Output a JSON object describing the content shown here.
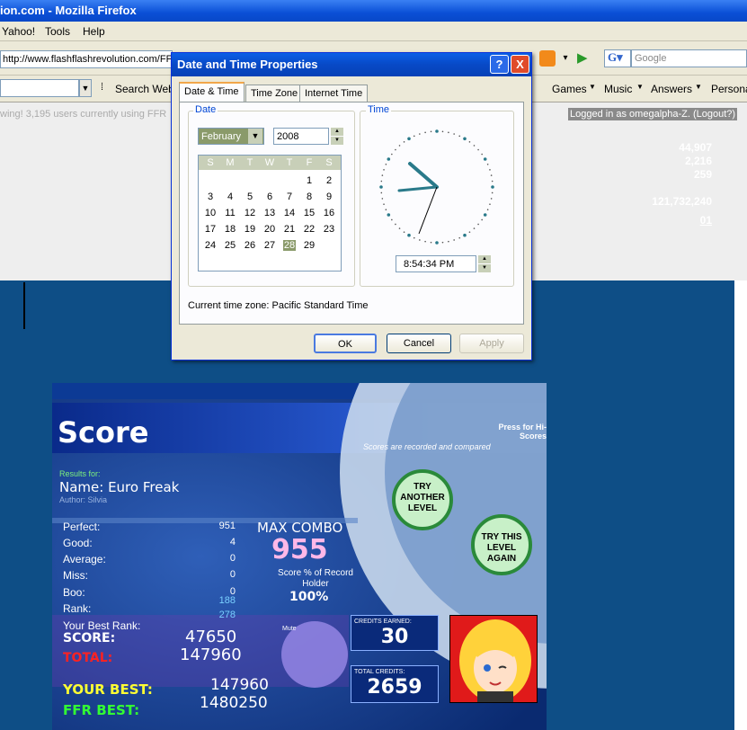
{
  "browser": {
    "title": "ion.com - Mozilla Firefox",
    "menu": [
      "Yahoo!",
      "Tools",
      "Help"
    ],
    "url": "http://www.flashflashrevolution.com/FFR",
    "search_placeholder": "Google",
    "search_web_label": "Search Web",
    "nav_links": [
      "Games",
      "Music",
      "Answers",
      "Persona"
    ]
  },
  "site": {
    "users_online": "wing! 3,195 users currently using FFR",
    "logged_in": "Logged in as omegalpha-Z. (Logout?)",
    "stats": [
      "44,907",
      "2,216",
      "259",
      "121,732,240",
      "01"
    ]
  },
  "dialog": {
    "title": "Date and Time Properties",
    "tabs": [
      "Date & Time",
      "Time Zone",
      "Internet Time"
    ],
    "date_label": "Date",
    "time_label": "Time",
    "month": "February",
    "year": "2008",
    "weekdays": [
      "S",
      "M",
      "T",
      "W",
      "T",
      "F",
      "S"
    ],
    "weeks": [
      [
        "",
        "",
        "",
        "",
        "",
        "1",
        "2"
      ],
      [
        "3",
        "4",
        "5",
        "6",
        "7",
        "8",
        "9"
      ],
      [
        "10",
        "11",
        "12",
        "13",
        "14",
        "15",
        "16"
      ],
      [
        "17",
        "18",
        "19",
        "20",
        "21",
        "22",
        "23"
      ],
      [
        "24",
        "25",
        "26",
        "27",
        "28",
        "29",
        ""
      ]
    ],
    "selected_day": "28",
    "time_value": "8:54:34 PM",
    "timezone_text": "Current time zone:  Pacific Standard Time",
    "ok": "OK",
    "cancel": "Cancel",
    "apply": "Apply",
    "help_glyph": "?",
    "close_glyph": "X"
  },
  "game": {
    "heading": "Score",
    "press_hiscores": "Press for Hi-Scores",
    "scores_recorded": "Scores are recorded and compared",
    "results_for": "Results for:",
    "song_name": "Name: Euro Freak",
    "author": "Author: Silvia",
    "judgements": [
      {
        "label": "Perfect:",
        "value": "951"
      },
      {
        "label": "Good:",
        "value": "4"
      },
      {
        "label": "Average:",
        "value": "0"
      },
      {
        "label": "Miss:",
        "value": "0"
      },
      {
        "label": "Boo:",
        "value": "0"
      },
      {
        "label": "Rank:",
        "value": "188"
      }
    ],
    "rank_extra": "278",
    "max_combo_label": "MAX COMBO",
    "max_combo": "955",
    "score_pct_label": "Score % of Record Holder",
    "score_pct": "100%",
    "try_another": "TRY ANOTHER LEVEL",
    "try_again": "TRY THIS LEVEL AGAIN",
    "best_rank_label": "Your Best Rank:",
    "score_label": "SCORE:",
    "score_value": "47650",
    "total_label": "TOTAL:",
    "total_value": "147960",
    "your_best_label": "YOUR BEST:",
    "your_best_value": "147960",
    "ffr_best_label": "FFR BEST:",
    "ffr_best_value": "1480250",
    "credits_earned_label": "CREDITS EARNED:",
    "credits_earned": "30",
    "total_credits_label": "TOTAL CREDITS:",
    "total_credits": "2659",
    "mute_label": "Mute"
  },
  "colors": {
    "xp_blue": "#0a5fe6",
    "page_blue": "#0e4e86",
    "game_green": "#33ff33",
    "game_red": "#ff2222",
    "game_yellow": "#ffff33"
  }
}
